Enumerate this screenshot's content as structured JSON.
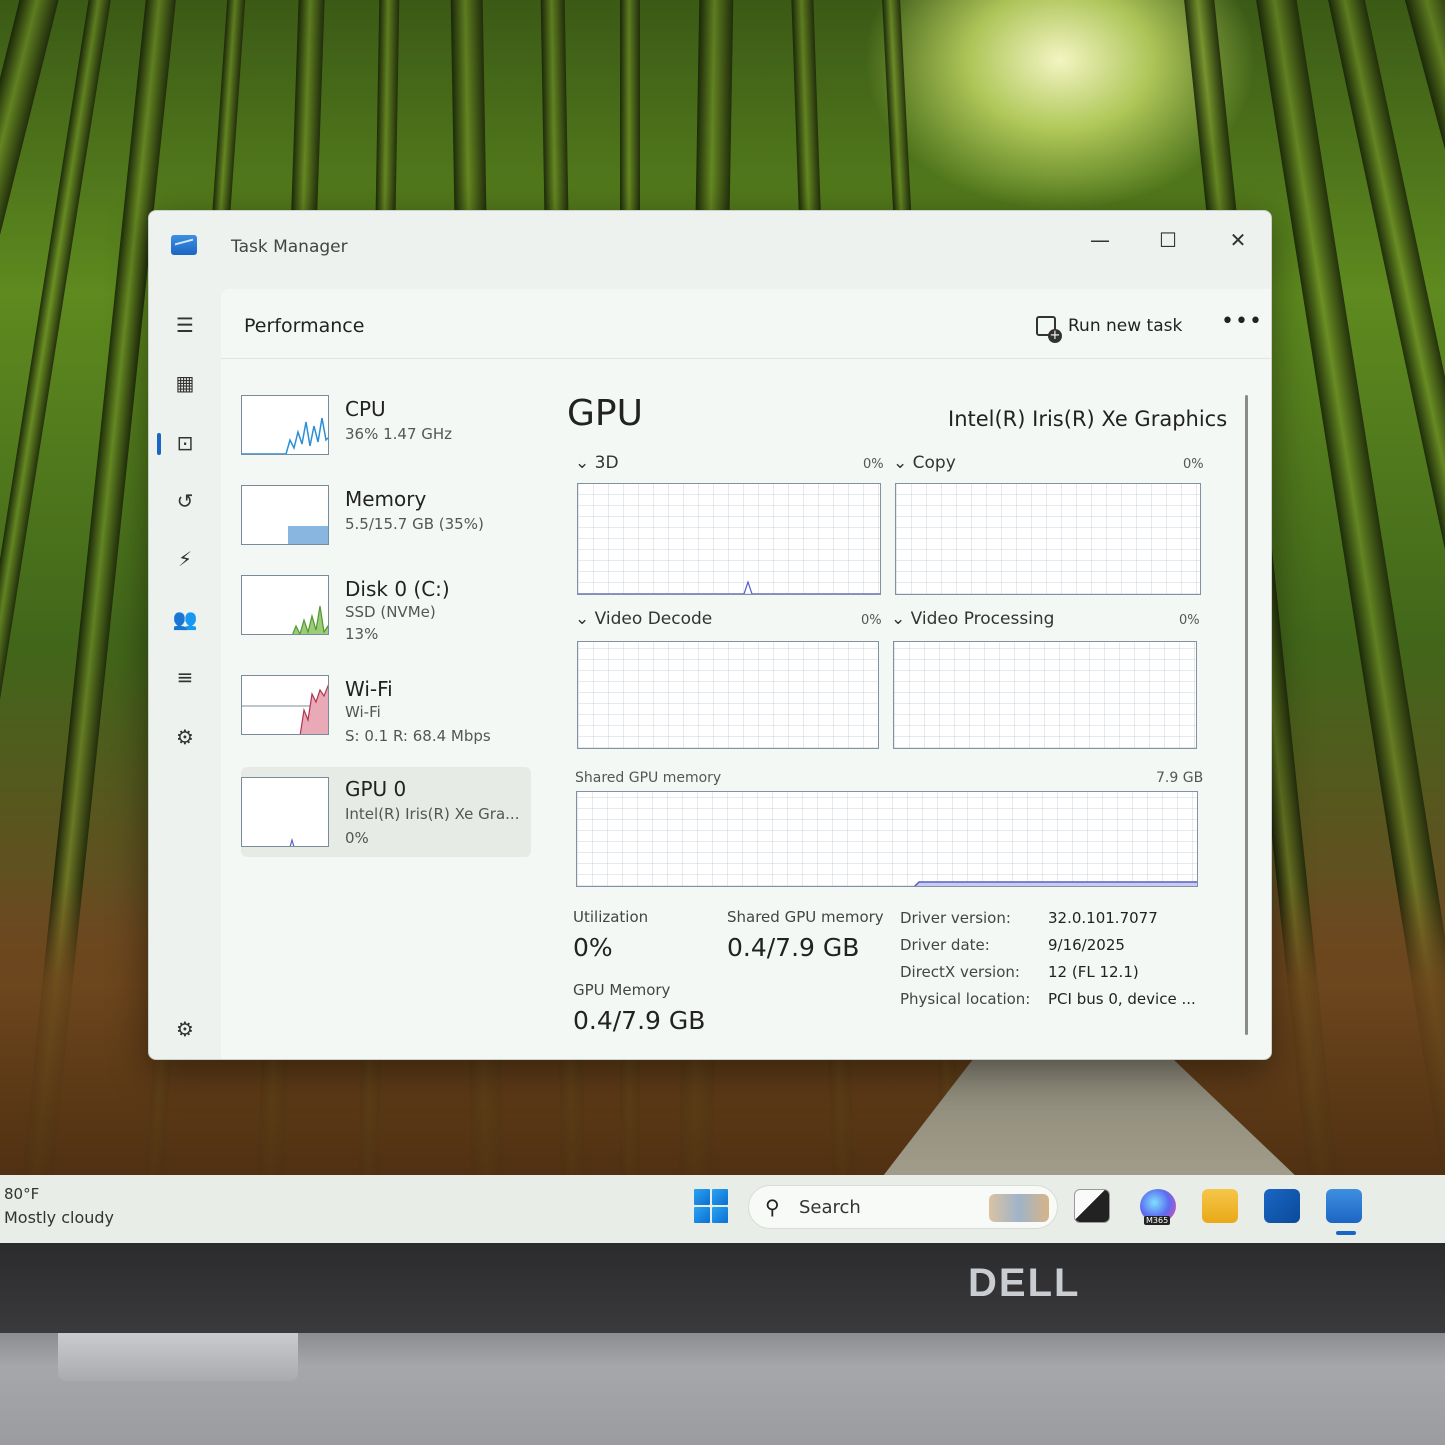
{
  "window": {
    "title": "Task Manager",
    "controls": {
      "minimize": "—",
      "maximize": "☐",
      "close": "✕"
    }
  },
  "nav": {
    "icons": [
      "hamburger-icon",
      "processes-icon",
      "performance-icon",
      "app-history-icon",
      "startup-apps-icon",
      "users-icon",
      "details-icon",
      "services-icon",
      "settings-icon"
    ]
  },
  "header": {
    "title": "Performance",
    "run_new_task": "Run new task",
    "more": "•••"
  },
  "resources": [
    {
      "name": "CPU",
      "line1": "36%  1.47 GHz",
      "line2": ""
    },
    {
      "name": "Memory",
      "line1": "5.5/15.7 GB (35%)",
      "line2": ""
    },
    {
      "name": "Disk 0 (C:)",
      "line1": "SSD (NVMe)",
      "line2": "13%"
    },
    {
      "name": "Wi-Fi",
      "line1": "Wi-Fi",
      "line2": "S: 0.1  R: 68.4 Mbps"
    },
    {
      "name": "GPU 0",
      "line1": "Intel(R) Iris(R) Xe Gra...",
      "line2": "0%"
    }
  ],
  "gpu": {
    "title": "GPU",
    "model": "Intel(R) Iris(R) Xe Graphics",
    "engines": [
      {
        "label": "3D",
        "pct": "0%"
      },
      {
        "label": "Copy",
        "pct": "0%"
      },
      {
        "label": "Video Decode",
        "pct": "0%"
      },
      {
        "label": "Video Processing",
        "pct": "0%"
      }
    ],
    "shared_memory_graph": {
      "label": "Shared GPU memory",
      "max": "7.9 GB"
    },
    "stats": {
      "utilization_label": "Utilization",
      "utilization_value": "0%",
      "shared_label": "Shared GPU memory",
      "shared_value": "0.4/7.9 GB",
      "gpu_memory_label": "GPU Memory",
      "gpu_memory_value": "0.4/7.9 GB"
    },
    "details": [
      {
        "label": "Driver version:",
        "value": "32.0.101.7077"
      },
      {
        "label": "Driver date:",
        "value": "9/16/2025"
      },
      {
        "label": "DirectX version:",
        "value": "12 (FL 12.1)"
      },
      {
        "label": "Physical location:",
        "value": "PCI bus 0, device ..."
      }
    ]
  },
  "taskbar": {
    "weather_temp": "80°F",
    "weather_desc": "Mostly cloudy",
    "search_placeholder": "Search",
    "m365_badge": "M365"
  },
  "brand": "DELL",
  "colors": {
    "accent": "#1b66c4",
    "cpu_line": "#2a8fd6",
    "memory_fill": "#6ba3d9",
    "disk_line": "#4f9a2e",
    "wifi_line": "#b0354f",
    "gpu_line": "#5a5fc8"
  }
}
